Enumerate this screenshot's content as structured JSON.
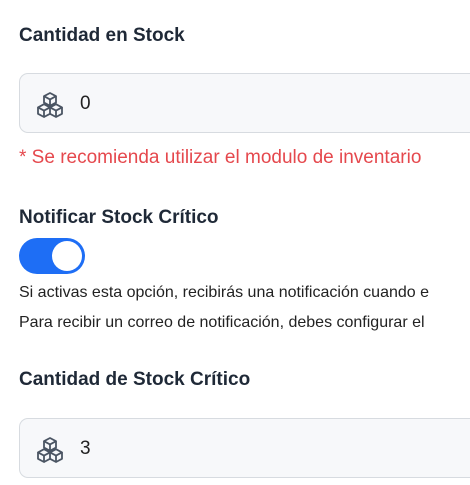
{
  "stock": {
    "label": "Cantidad en Stock",
    "value": "0",
    "icon": "cubes-icon",
    "warning": "* Se recomienda utilizar el modulo de inventario"
  },
  "notify": {
    "label": "Notificar Stock Crítico",
    "enabled": true,
    "help_line_1": "Si activas esta opción, recibirás una notificación cuando e",
    "help_line_2": "Para recibir un correo de notificación, debes configurar el"
  },
  "critical": {
    "label": "Cantidad de Stock Crítico",
    "value": "3",
    "icon": "cubes-icon"
  },
  "colors": {
    "accent": "#1e6ef5",
    "warning": "#e5484d",
    "input_bg": "#f7f8fa",
    "input_border": "#d7dbe0"
  }
}
